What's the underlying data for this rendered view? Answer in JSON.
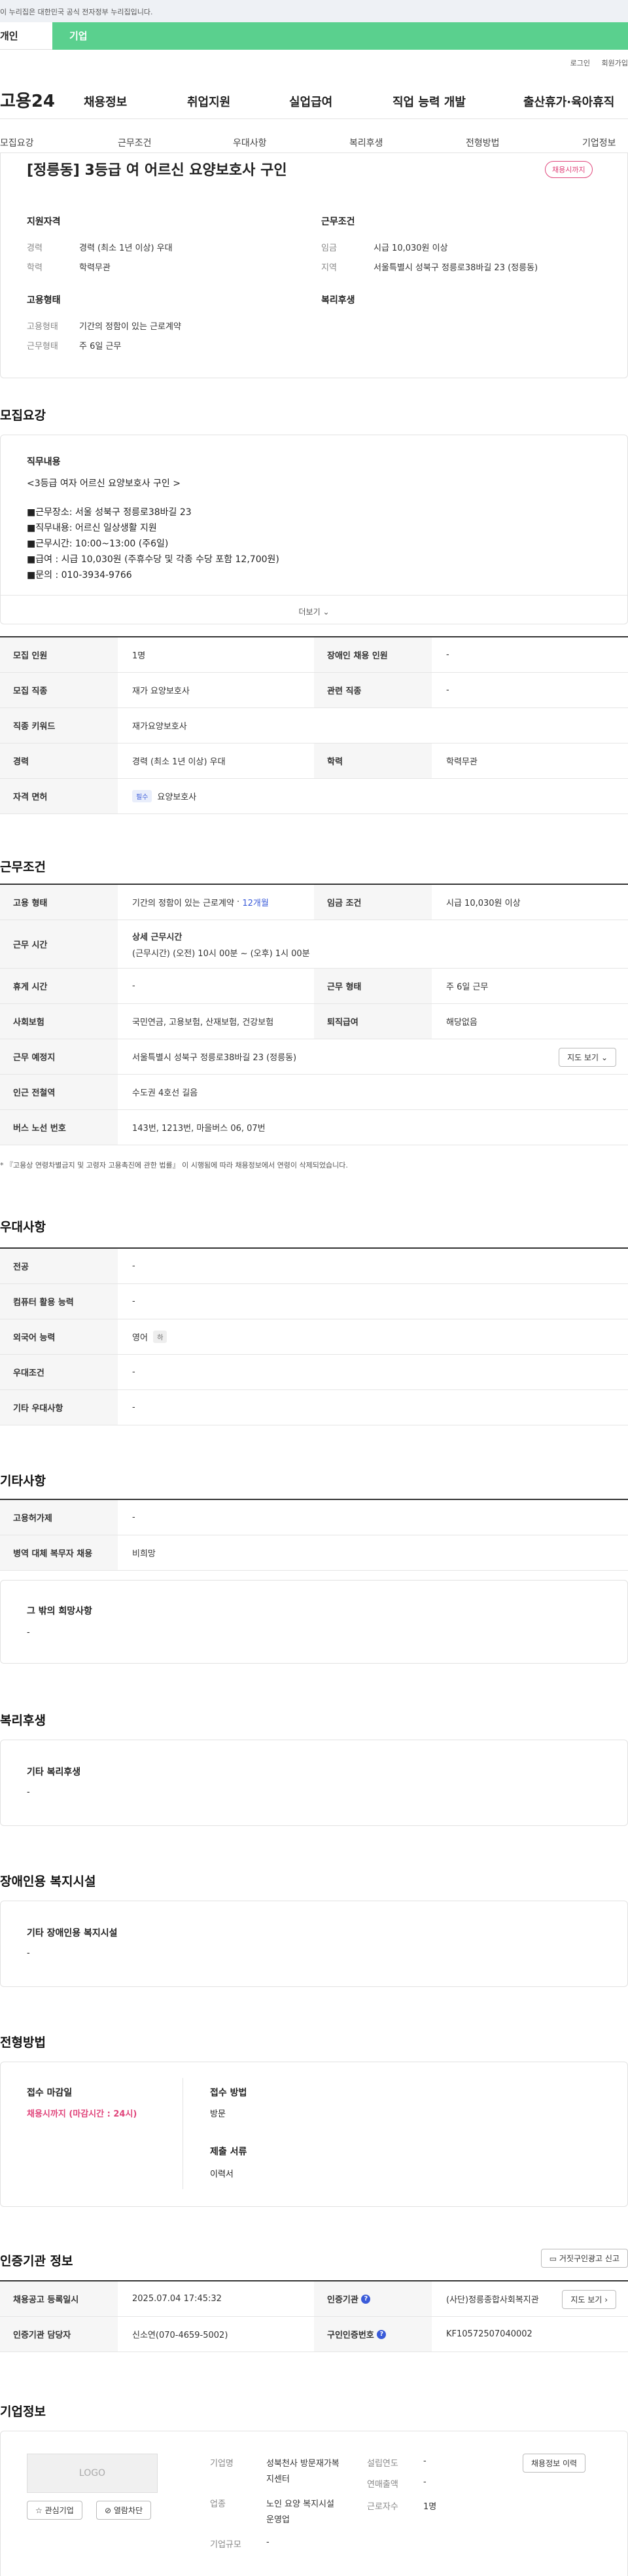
{
  "banner": {
    "text": "이 누리집은 대한민국 공식 전자정부 누리집입니다."
  },
  "top_tabs": [
    "개인",
    "기업"
  ],
  "utils": [
    "로그인",
    "회원가입"
  ],
  "gnb": {
    "logo": "고용24",
    "menus": [
      "채용정보",
      "취업지원",
      "실업급여",
      "직업 능력 개발",
      "출산휴가·육아휴직"
    ]
  },
  "subnav": [
    "모집요강",
    "근무조건",
    "우대사항",
    "복리후생",
    "전형방법",
    "기업정보"
  ],
  "job": {
    "title": "[정릉동] 3등급 여 어르신 요양보호사 구인",
    "status_badge": "채용시까지",
    "qual_title": "지원자격",
    "qual": [
      {
        "k": "경력",
        "v": "경력 (최소 1년 이상) 우대"
      },
      {
        "k": "학력",
        "v": "학력무관"
      }
    ],
    "cond_title": "근무조건",
    "cond": [
      {
        "k": "임금",
        "v": "시급 10,030원 이상"
      },
      {
        "k": "지역",
        "v": "서울특별시 성북구 정릉로38바길 23 (정릉동)"
      }
    ],
    "emp_title": "고용형태",
    "emp": [
      {
        "k": "고용형태",
        "v": "기간의 정함이 있는 근로계약"
      },
      {
        "k": "근무형태",
        "v": "주 6일 근무"
      }
    ],
    "welfare_title": "복리후생"
  },
  "recruit": {
    "section_title": "모집요강",
    "duty_title": "직무내용",
    "duty_sub": "<3등급 여자 어르신 요양보호사 구인 >",
    "duty_lines": [
      "■근무장소: 서울 성북구 정릉로38바길 23",
      "■직무내용: 어르신 일상생활 지원",
      "■근무시간: 10:00~13:00 (주6일)",
      "■급여 : 시급 10,030원 (주휴수당 및 각종 수당 포함 12,700원)",
      "■문의 : 010-3934-9766"
    ],
    "more": "더보기",
    "rows": [
      {
        "k1": "모집 인원",
        "v1": "1명",
        "k2": "장애인 채용 인원",
        "v2": "-"
      },
      {
        "k1": "모집 직종",
        "v1": "재가 요양보호사",
        "k2": "관련 직종",
        "v2": "-"
      },
      {
        "k1": "직종 키워드",
        "v1": "재가요양보호사"
      },
      {
        "k1": "경력",
        "v1": "경력 (최소 1년 이상) 우대",
        "k2": "학력",
        "v2": "학력무관"
      },
      {
        "k1": "자격 면허",
        "chip": "필수",
        "v1": "요양보호사"
      }
    ]
  },
  "work": {
    "section_title": "근무조건",
    "emp_type_label": "고용 형태",
    "emp_type": "기간의 정함이 있는 근로계약",
    "emp_period": "12개월",
    "wage_label": "임금 조건",
    "wage": "시급 10,030원 이상",
    "hours_label": "근무 시간",
    "hours_title": "상세 근무시간",
    "hours_detail": "(근무시간) (오전) 10시 00분 ~ (오후) 1시 00분",
    "rest_label": "휴게 시간",
    "rest": "-",
    "form_label": "근무 형태",
    "form": "주 6일 근무",
    "insurance_label": "사회보험",
    "insurance": "국민연금, 고용보험, 산재보험, 건강보험",
    "retire_label": "퇴직급여",
    "retire": "해당없음",
    "place_label": "근무 예정지",
    "place": "서울특별시 성북구 정릉로38바길 23 (정릉동)",
    "map_btn": "지도 보기",
    "subway_label": "인근 전철역",
    "subway": "수도권 4호선 길음",
    "bus_label": "버스 노선 번호",
    "bus": "143번, 1213번, 마을버스 06, 07번",
    "note": "* 『고용상 연령차별금지 및 고령자 고용촉진에 관한 법률』 이 시행됨에 따라 채용정보에서 연령이 삭제되었습니다."
  },
  "pref": {
    "section_title": "우대사항",
    "rows": [
      {
        "k": "전공",
        "v": "-"
      },
      {
        "k": "컴퓨터 활용 능력",
        "v": "-"
      },
      {
        "k": "외국어 능력",
        "v": "영어",
        "chip": "하"
      },
      {
        "k": "우대조건",
        "v": "-"
      },
      {
        "k": "기타 우대사항",
        "v": "-"
      }
    ]
  },
  "etc": {
    "section_title": "기타사항",
    "rows": [
      {
        "k": "고용허가제",
        "v": "-"
      },
      {
        "k": "병역 대체 복무자 채용",
        "v": "비희망"
      }
    ],
    "hope_title": "그 밖의 희망사항",
    "hope": "-"
  },
  "welfare": {
    "section_title": "복리후생",
    "box_title": "기타 복리후생",
    "box_val": "-"
  },
  "disabled": {
    "section_title": "장애인용 복지시설",
    "box_title": "기타 장애인용 복지시설",
    "box_val": "-"
  },
  "process": {
    "section_title": "전형방법",
    "deadline_title": "접수 마감일",
    "deadline": "채용시까지 (마감시간 : 24시)",
    "method_title": "접수 방법",
    "method": "방문",
    "docs_title": "제출 서류",
    "docs": "이력서"
  },
  "cert": {
    "section_title": "인증기관 정보",
    "report_btn": "거짓구인광고 신고",
    "rows": [
      {
        "k1": "채용공고 등록일시",
        "v1": "2025.07.04 17:45:32",
        "k2": "인증기관",
        "v2": "(사단)정릉종합사회복지관",
        "btn": "지도 보기"
      },
      {
        "k1": "인증기관 담당자",
        "v1": "신소연(070-4659-5002)",
        "k2": "구인인증번호",
        "v2": "KF10572507040002"
      }
    ]
  },
  "company": {
    "section_title": "기업정보",
    "logo_text": "LOGO",
    "fav_btn": "관심기업",
    "block_btn": "열람차단",
    "name_k": "기업명",
    "name_v": "성북천사 방문재가복지센터",
    "industry_k": "업종",
    "industry_v": "노인 요양 복지시설 운영업",
    "size_k": "기업규모",
    "size_v": "-",
    "year_k": "설립연도",
    "year_v": "-",
    "sales_k": "연매출액",
    "sales_v": "-",
    "emp_k": "근로자수",
    "emp_v": "1명",
    "history_btn": "채용정보 이력"
  }
}
